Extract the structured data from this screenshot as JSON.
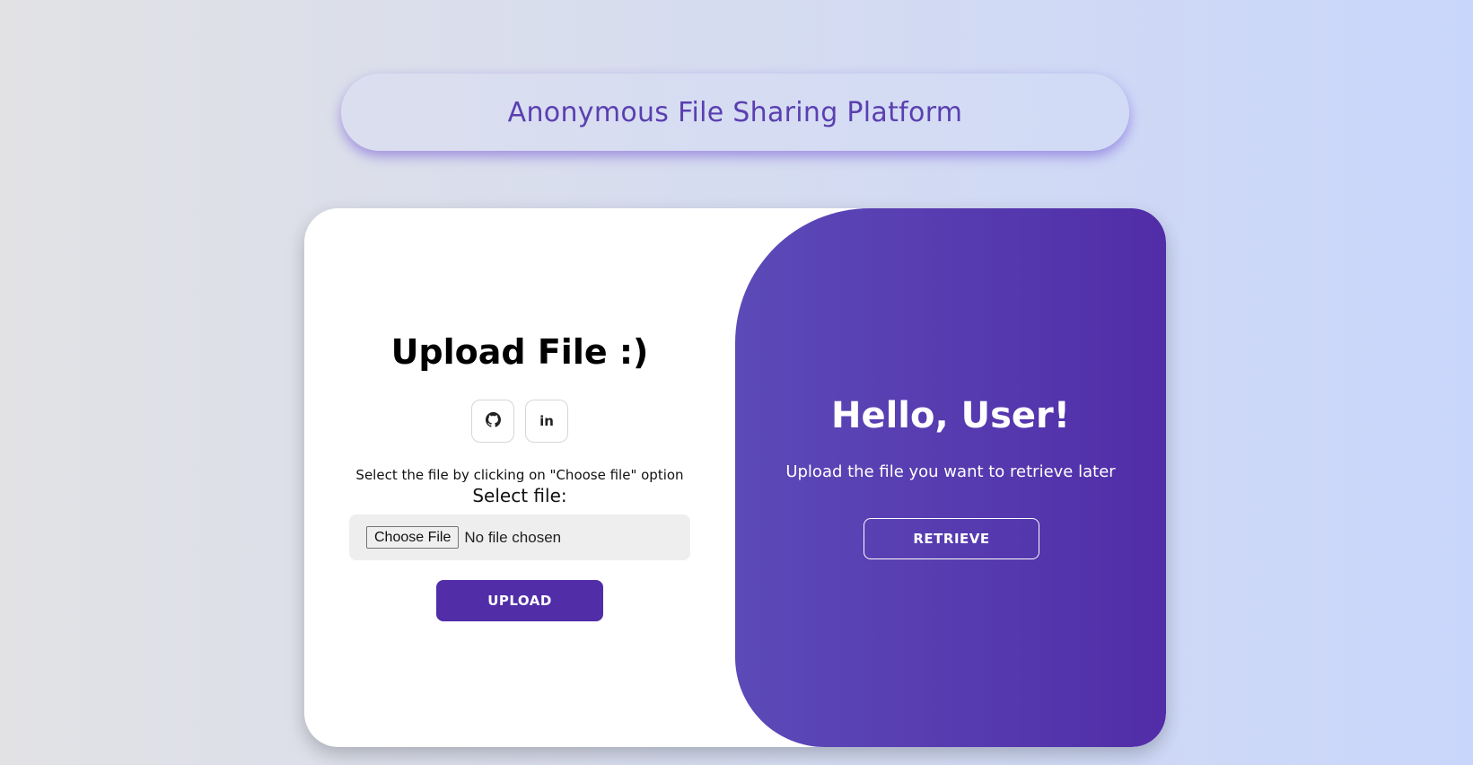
{
  "header": {
    "title": "Anonymous File Sharing Platform"
  },
  "upload_panel": {
    "title": "Upload File :)",
    "social": [
      {
        "icon": "github-icon"
      },
      {
        "icon": "linkedin-icon"
      }
    ],
    "linkedin_glyph": "in",
    "instruction": "Select the file by clicking on \"Choose file\" option",
    "select_label": "Select file:",
    "choose_button_label": "Choose File",
    "file_status": "No file chosen",
    "upload_button_label": "UPLOAD"
  },
  "retrieve_panel": {
    "title": "Hello, User!",
    "subtitle": "Upload the file you want to retrieve later",
    "retrieve_button_label": "RETRIEVE"
  },
  "colors": {
    "accent": "#512da8",
    "header_text": "#5a3fb0",
    "panel_gradient_start": "#5c4ab8",
    "panel_gradient_end": "#512da8"
  }
}
